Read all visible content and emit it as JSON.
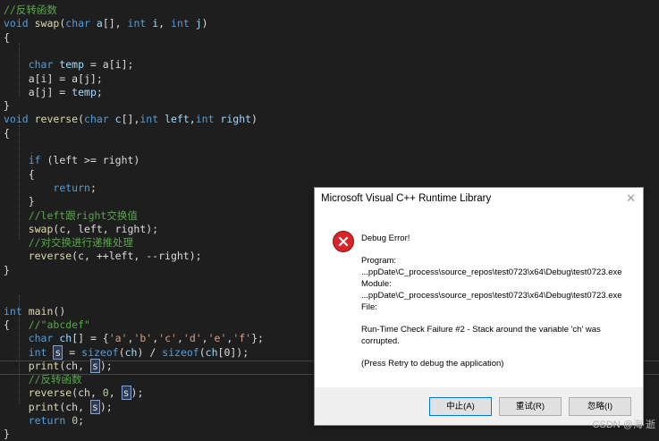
{
  "editor": {
    "lines": [
      [
        [
          "cmt",
          "//反转函数"
        ]
      ],
      [
        [
          "kw",
          "void"
        ],
        [
          "fn",
          " swap"
        ],
        [
          "plain",
          "("
        ],
        [
          "kw",
          "char"
        ],
        [
          "var",
          " a"
        ],
        [
          "plain",
          "[], "
        ],
        [
          "kw",
          "int"
        ],
        [
          "var",
          " i"
        ],
        [
          "plain",
          ", "
        ],
        [
          "kw",
          "int"
        ],
        [
          "var",
          " j"
        ],
        [
          "plain",
          ")"
        ]
      ],
      [
        [
          "plain",
          "{"
        ]
      ],
      [
        [
          "plain",
          ""
        ]
      ],
      [
        [
          "plain",
          "    "
        ],
        [
          "kw",
          "char"
        ],
        [
          "var",
          " temp"
        ],
        [
          "plain",
          " = a[i];"
        ]
      ],
      [
        [
          "plain",
          "    a[i] = a[j];"
        ]
      ],
      [
        [
          "plain",
          "    a[j] = "
        ],
        [
          "var",
          "temp"
        ],
        [
          "plain",
          ";"
        ]
      ],
      [
        [
          "plain",
          "}"
        ]
      ],
      [
        [
          "kw",
          "void"
        ],
        [
          "fn",
          " reverse"
        ],
        [
          "plain",
          "("
        ],
        [
          "kw",
          "char"
        ],
        [
          "var",
          " c"
        ],
        [
          "plain",
          "[],"
        ],
        [
          "kw",
          "int"
        ],
        [
          "var",
          " left"
        ],
        [
          "plain",
          ","
        ],
        [
          "kw",
          "int"
        ],
        [
          "var",
          " right"
        ],
        [
          "plain",
          ")"
        ]
      ],
      [
        [
          "plain",
          "{"
        ]
      ],
      [
        [
          "plain",
          ""
        ]
      ],
      [
        [
          "plain",
          "    "
        ],
        [
          "kw",
          "if"
        ],
        [
          "plain",
          " (left >= right)"
        ]
      ],
      [
        [
          "plain",
          "    {"
        ]
      ],
      [
        [
          "plain",
          "        "
        ],
        [
          "kw",
          "return"
        ],
        [
          "plain",
          ";"
        ]
      ],
      [
        [
          "plain",
          "    }"
        ]
      ],
      [
        [
          "cmt",
          "    //left跟right交换值"
        ]
      ],
      [
        [
          "fn",
          "    swap"
        ],
        [
          "plain",
          "(c, left, right);"
        ]
      ],
      [
        [
          "cmt",
          "    //对交换进行递推处理"
        ]
      ],
      [
        [
          "fn",
          "    reverse"
        ],
        [
          "plain",
          "(c, ++left, --right);"
        ]
      ],
      [
        [
          "plain",
          "}"
        ]
      ],
      [
        [
          "plain",
          ""
        ]
      ],
      [
        [
          "plain",
          ""
        ]
      ],
      [
        [
          "kw",
          "int"
        ],
        [
          "fn",
          " main"
        ],
        [
          "plain",
          "()"
        ]
      ],
      [
        [
          "plain",
          "{   "
        ],
        [
          "cmt",
          "//\"abcdef\""
        ]
      ],
      [
        [
          "plain",
          "    "
        ],
        [
          "kw",
          "char"
        ],
        [
          "var",
          " ch"
        ],
        [
          "plain",
          "[] = {"
        ],
        [
          "str",
          "'a'"
        ],
        [
          "plain",
          ","
        ],
        [
          "str",
          "'b'"
        ],
        [
          "plain",
          ","
        ],
        [
          "str",
          "'c'"
        ],
        [
          "plain",
          ","
        ],
        [
          "str",
          "'d'"
        ],
        [
          "plain",
          ","
        ],
        [
          "str",
          "'e'"
        ],
        [
          "plain",
          ","
        ],
        [
          "str",
          "'f'"
        ],
        [
          "plain",
          "};"
        ]
      ],
      [
        [
          "plain",
          "    "
        ],
        [
          "kw",
          "int"
        ],
        [
          "plain",
          " "
        ],
        [
          "hl",
          "s"
        ],
        [
          "plain",
          " = "
        ],
        [
          "kw",
          "sizeof"
        ],
        [
          "plain",
          "("
        ],
        [
          "var",
          "ch"
        ],
        [
          "plain",
          ") / "
        ],
        [
          "kw",
          "sizeof"
        ],
        [
          "plain",
          "("
        ],
        [
          "var",
          "ch"
        ],
        [
          "plain",
          "[0]);"
        ]
      ],
      [
        [
          "fn",
          "    print"
        ],
        [
          "plain",
          "(ch, "
        ],
        [
          "hl",
          "s"
        ],
        [
          "plain",
          ");"
        ]
      ],
      [
        [
          "cmt",
          "    //反转函数"
        ]
      ],
      [
        [
          "fn",
          "    reverse"
        ],
        [
          "plain",
          "(ch, "
        ],
        [
          "num",
          "0"
        ],
        [
          "plain",
          ", "
        ],
        [
          "hl",
          "s"
        ],
        [
          "plain",
          ");"
        ]
      ],
      [
        [
          "fn",
          "    print"
        ],
        [
          "plain",
          "(ch, "
        ],
        [
          "hl",
          "s"
        ],
        [
          "plain",
          ");"
        ]
      ],
      [
        [
          "plain",
          "    "
        ],
        [
          "kw",
          "return"
        ],
        [
          "plain",
          " "
        ],
        [
          "num",
          "0"
        ],
        [
          "plain",
          ";"
        ]
      ],
      [
        [
          "plain",
          "}"
        ]
      ]
    ]
  },
  "dialog": {
    "title": "Microsoft Visual C++ Runtime Library",
    "close_glyph": "✕",
    "heading": "Debug Error!",
    "program_label": "Program:",
    "program_path": "...ppDate\\C_process\\source_repos\\test0723\\x64\\Debug\\test0723.exe",
    "module_label": "Module:",
    "module_path": "...ppDate\\C_process\\source_repos\\test0723\\x64\\Debug\\test0723.exe",
    "file_label": "File:",
    "failure_line1": "Run-Time Check Failure #2 - Stack around the variable 'ch' was",
    "failure_line2": "corrupted.",
    "hint": "(Press Retry to debug the application)",
    "buttons": {
      "abort": "中止(A)",
      "retry": "重试(R)",
      "ignore": "忽略(I)"
    },
    "icon": "error-icon"
  },
  "watermark": "CSDN @海 逝"
}
